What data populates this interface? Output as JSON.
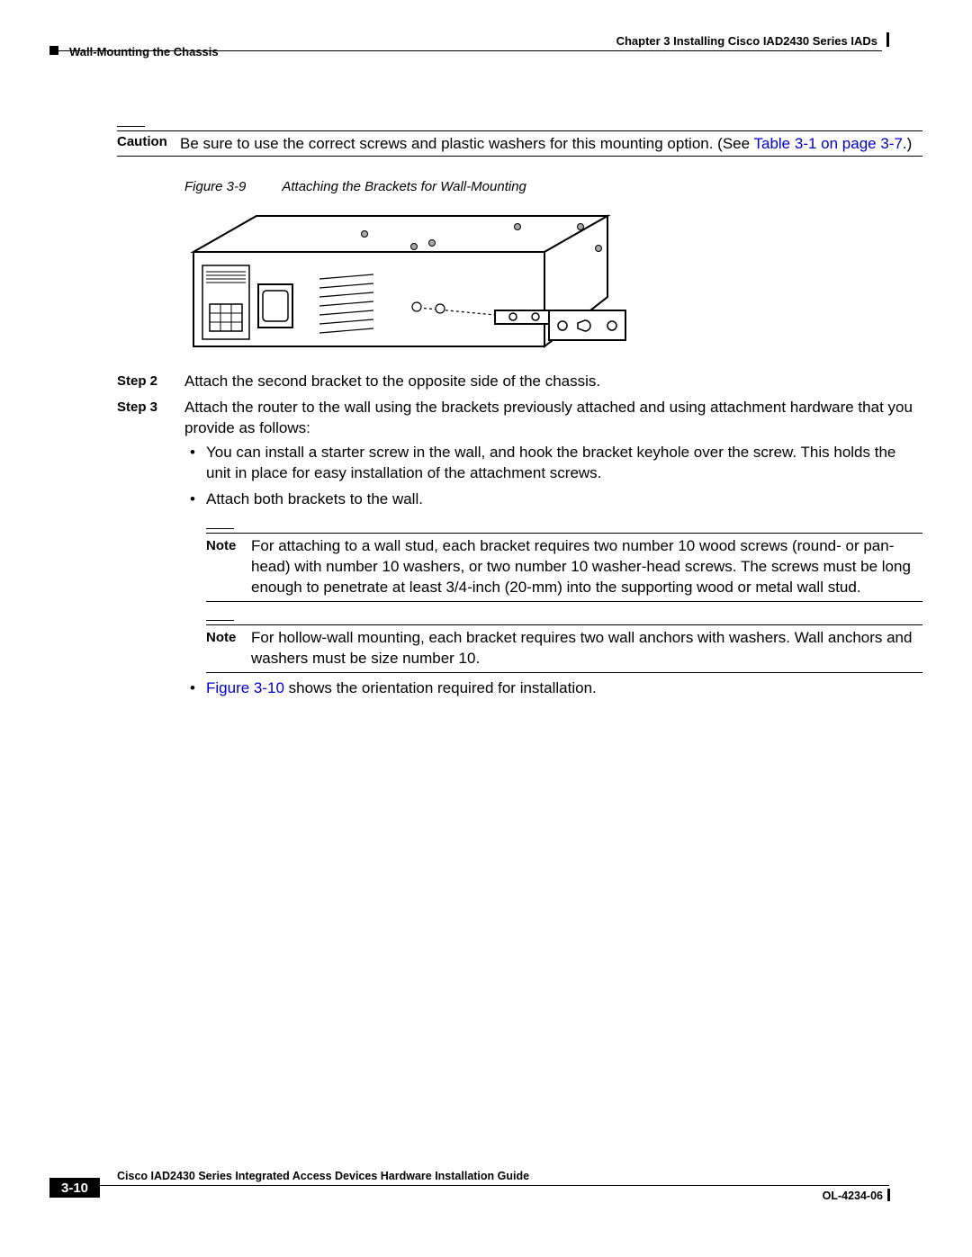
{
  "header": {
    "chapter": "Chapter 3      Installing Cisco IAD2430 Series IADs",
    "section": "Wall-Mounting the Chassis"
  },
  "caution": {
    "label": "Caution",
    "text_prefix": "Be sure to use the correct screws and plastic washers for this mounting option. (See ",
    "link_text": "Table 3-1 on page 3-7",
    "text_suffix": ".)"
  },
  "figure": {
    "label": "Figure 3-9",
    "title": "Attaching the Brackets for Wall-Mounting"
  },
  "steps": [
    {
      "label": "Step 2",
      "body": "Attach the second bracket to the opposite side of the chassis."
    },
    {
      "label": "Step 3",
      "body": "Attach the router to the wall using the brackets previously attached and using attachment hardware that you provide as follows:"
    }
  ],
  "bullets": {
    "b1": "You can install a starter screw in the wall, and hook the bracket keyhole over the screw. This holds the unit in place for easy installation of the attachment screws.",
    "b2": "Attach both brackets to the wall.",
    "b3_link": "Figure 3-10",
    "b3_rest": " shows the orientation required for installation."
  },
  "notes": {
    "label": "Note",
    "n1": "For attaching to a wall stud, each bracket requires two number 10 wood screws (round- or pan-head) with number 10 washers, or two number 10 washer-head screws. The screws must be long enough to penetrate at least 3/4-inch (20-mm) into the supporting wood or metal wall stud.",
    "n2": "For hollow-wall mounting, each bracket requires two wall anchors with washers. Wall anchors and washers must be size number 10."
  },
  "footer": {
    "title": "Cisco IAD2430 Series Integrated Access Devices Hardware Installation Guide",
    "page": "3-10",
    "doc": "OL-4234-06"
  }
}
